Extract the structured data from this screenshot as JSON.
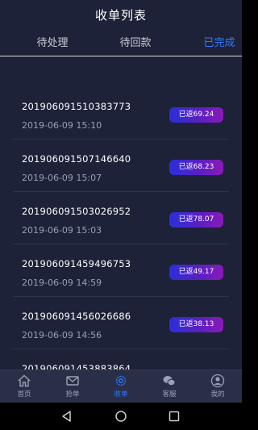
{
  "header": {
    "title": "收单列表",
    "tabs": [
      {
        "label": "待处理",
        "active": false
      },
      {
        "label": "待回款",
        "active": false
      },
      {
        "label": "已完成",
        "active": true
      }
    ]
  },
  "orders": [
    {
      "order_no": "201906091510383773",
      "time": "2019-06-09 15:10",
      "status": "已返69.24"
    },
    {
      "order_no": "201906091507146640",
      "time": "2019-06-09 15:07",
      "status": "已返68.23"
    },
    {
      "order_no": "201906091503026952",
      "time": "2019-06-09 15:03",
      "status": "已返78.07"
    },
    {
      "order_no": "201906091459496753",
      "time": "2019-06-09 14:59",
      "status": "已返49.17"
    },
    {
      "order_no": "201906091456026686",
      "time": "2019-06-09 14:56",
      "status": "已返38.13"
    },
    {
      "order_no": "201906091453883864",
      "time": "",
      "status": ""
    }
  ],
  "tabbar": {
    "items": [
      {
        "label": "首页",
        "icon": "home-icon",
        "active": false
      },
      {
        "label": "抢单",
        "icon": "mail-icon",
        "active": false
      },
      {
        "label": "收单",
        "icon": "gear-icon",
        "active": true
      },
      {
        "label": "客服",
        "icon": "chat-icon",
        "active": false
      },
      {
        "label": "我的",
        "icon": "person-icon",
        "active": false
      }
    ]
  },
  "colors": {
    "background": "#1e2238",
    "accent": "#2b7cff",
    "badge_start": "#2a2fd8",
    "badge_end": "#8a1ab8"
  }
}
